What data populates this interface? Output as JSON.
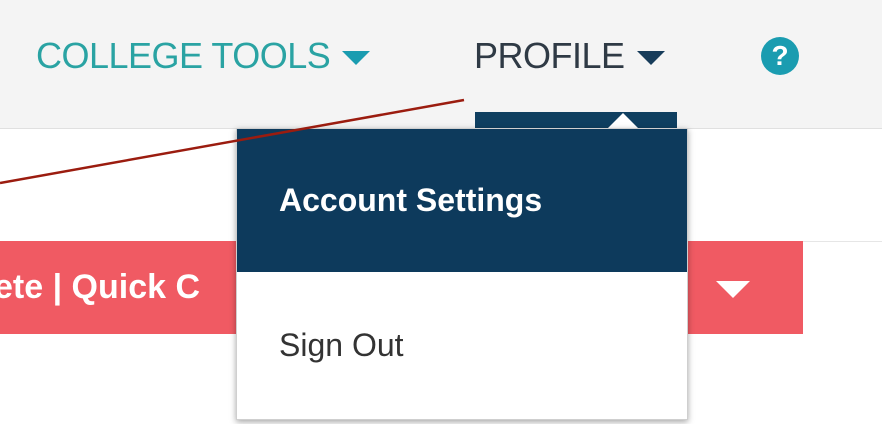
{
  "header": {
    "college_tools_label": "COLLEGE TOOLS",
    "profile_label": "PROFILE",
    "help_symbol": "?"
  },
  "banner": {
    "label": "ete | Quick C"
  },
  "profile_menu": {
    "items": [
      {
        "label": "Account Settings",
        "active": true
      },
      {
        "label": "Sign Out",
        "active": false
      }
    ]
  },
  "colors": {
    "teal_accent": "#2aa3a3",
    "navy": "#0d3a5c",
    "alert_red": "#f05a63",
    "annotation_line": "#9b1c0f"
  },
  "icons": {
    "college_tools_caret": "caret-down-icon",
    "profile_caret": "caret-down-icon",
    "help": "help-circle-icon",
    "banner_caret": "caret-down-icon"
  }
}
